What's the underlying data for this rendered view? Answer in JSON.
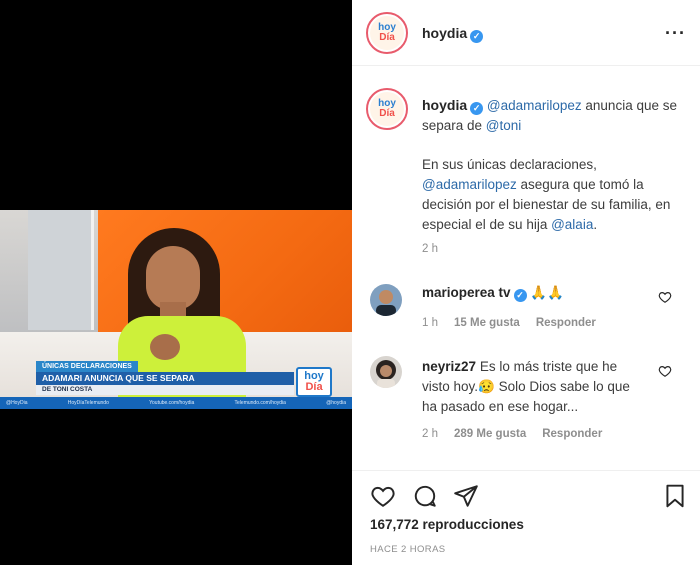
{
  "video": {
    "kicker": "ÚNICAS DECLARACIONES",
    "headline": "ADAMARI ANUNCIA QUE SE SEPARA",
    "subline": "DE TONI COSTA",
    "social": [
      "@HoyDia",
      "HoyDíaTelemundo",
      "Youtube.com/hoydia",
      "Telemundo.com/hoydia",
      "@hoydia"
    ],
    "logo_line1": "hoy",
    "logo_line2": "Día"
  },
  "header": {
    "avatar_line1": "hoy",
    "avatar_line2": "Día",
    "username": "hoydia",
    "more": "···"
  },
  "caption": {
    "username": "hoydia",
    "mention1": "@adamarilopez",
    "text1": " anuncia que se separa de ",
    "mention2": "@toni",
    "text2": "En sus únicas declaraciones, ",
    "mention3": "@adamarilopez",
    "text3": " asegura que tomó la decisión por el bienestar de su familia, en especial el de su hija ",
    "mention4": "@alaia",
    "text4": ".",
    "time": "2 h"
  },
  "comments": [
    {
      "username": "marioperea tv",
      "text": "🙏🙏",
      "time": "1 h",
      "likes": "15 Me gusta",
      "reply": "Responder"
    },
    {
      "username": "neyriz27",
      "text": "Es lo más triste que he visto hoy.😥 Solo Dios sabe lo que ha pasado en ese hogar...",
      "time": "2 h",
      "likes": "289 Me gusta",
      "reply": "Responder"
    }
  ],
  "footer": {
    "views": "167,772 reproducciones",
    "ago": "HACE 2 HORAS"
  },
  "colors": {
    "link": "#2d6aa8",
    "verified": "#3897f0",
    "muted": "#8e8e8e",
    "brand_blue": "#1f78c9",
    "brand_red": "#f0504a"
  }
}
